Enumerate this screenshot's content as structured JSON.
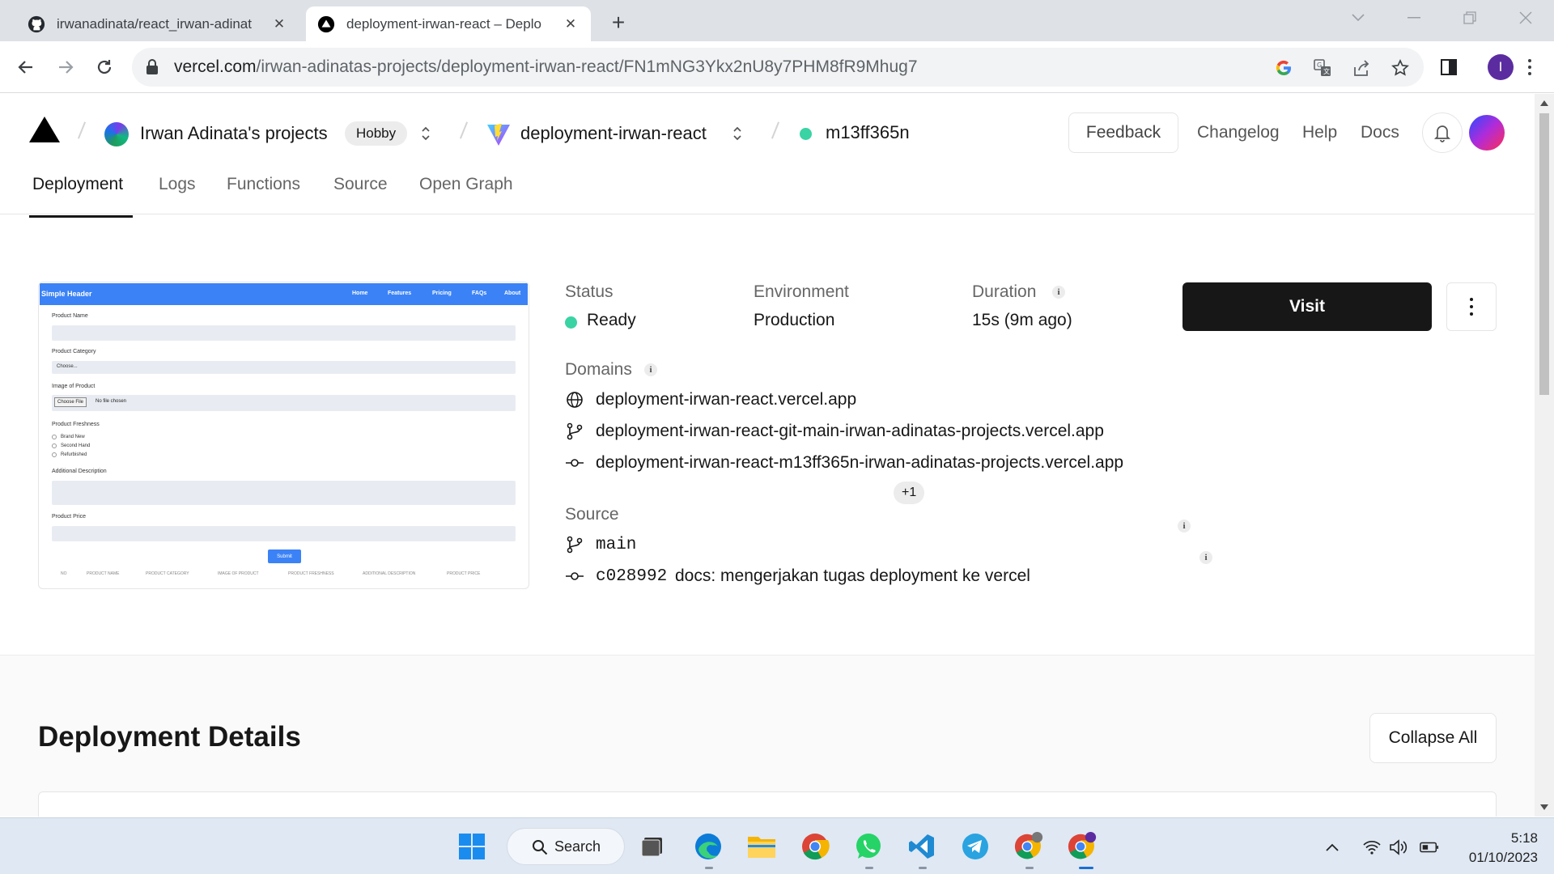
{
  "browser": {
    "tabs": [
      {
        "title": "irwanadinata/react_irwan-adinat",
        "active": false
      },
      {
        "title": "deployment-irwan-react – Deplo",
        "active": true
      }
    ],
    "url_host": "vercel.com",
    "url_path": "/irwan-adinatas-projects/deployment-irwan-react/FN1mNG3Ykx2nU8y7PHM8fR9Mhug7",
    "profile_initial": "I"
  },
  "header": {
    "team_name": "Irwan Adinata's projects",
    "plan_badge": "Hobby",
    "project_name": "deployment-irwan-react",
    "deployment_id": "m13ff365n",
    "feedback_label": "Feedback",
    "links": [
      "Changelog",
      "Help",
      "Docs"
    ]
  },
  "subtabs": [
    "Deployment",
    "Logs",
    "Functions",
    "Source",
    "Open Graph"
  ],
  "preview": {
    "brand": "Simple Header",
    "nav": [
      "Home",
      "Features",
      "Pricing",
      "FAQs",
      "About"
    ],
    "labels": {
      "product_name": "Product Name",
      "product_category": "Product Category",
      "image_of_product": "Image of Product",
      "product_freshness": "Product Freshness",
      "additional_description": "Additional Description",
      "product_price": "Product Price"
    },
    "select_placeholder": "Choose...",
    "file_button": "Choose File",
    "file_text": "No file chosen",
    "radios": [
      "Brand New",
      "Second Hand",
      "Refurbished"
    ],
    "submit": "Submit",
    "columns": [
      "NO",
      "PRODUCT NAME",
      "PRODUCT CATEGORY",
      "IMAGE OF PRODUCT",
      "PRODUCT FRESHNESS",
      "ADDITIONAL DESCRIPTION",
      "PRODUCT PRICE"
    ]
  },
  "deployment": {
    "status_label": "Status",
    "status_value": "Ready",
    "environment_label": "Environment",
    "environment_value": "Production",
    "duration_label": "Duration",
    "duration_value": "15s (9m ago)",
    "visit_label": "Visit",
    "domains_label": "Domains",
    "domains": [
      "deployment-irwan-react.vercel.app",
      "deployment-irwan-react-git-main-irwan-adinatas-projects.vercel.app",
      "deployment-irwan-react-m13ff365n-irwan-adinatas-projects.vercel.app"
    ],
    "domains_extra": "+1",
    "source_label": "Source",
    "branch": "main",
    "commit_hash": "c028992",
    "commit_message": "docs: mengerjakan tugas deployment ke vercel"
  },
  "details": {
    "title": "Deployment Details",
    "collapse_label": "Collapse All"
  },
  "taskbar": {
    "search_label": "Search",
    "time": "5:18",
    "date": "01/10/2023"
  },
  "colors": {
    "ready_green": "#3ad3a3",
    "visit_bg": "#171717",
    "preview_blue": "#3b82f6"
  }
}
